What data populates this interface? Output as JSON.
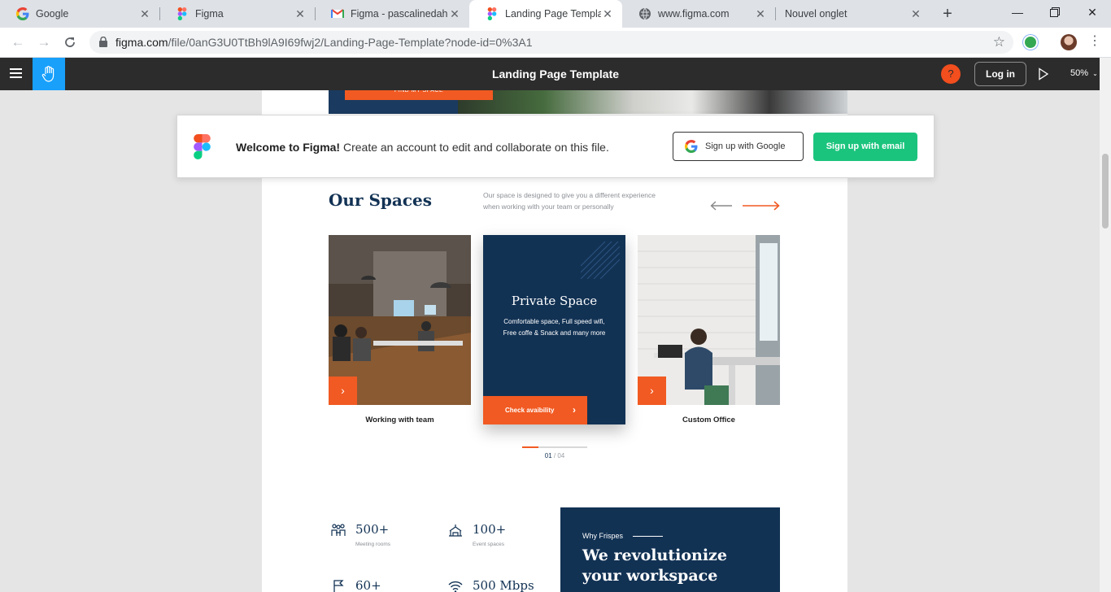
{
  "browser": {
    "tabs": [
      {
        "title": "Google",
        "icon": "google-icon"
      },
      {
        "title": "Figma",
        "icon": "figma-icon"
      },
      {
        "title": "Figma - pascalinedahzin",
        "icon": "gmail-icon"
      },
      {
        "title": "Landing Page Template",
        "icon": "figma-icon",
        "active": true
      },
      {
        "title": "www.figma.com",
        "icon": "globe-icon"
      },
      {
        "title": "Nouvel onglet",
        "icon": ""
      }
    ],
    "new_tab": "+",
    "url_host": "figma.com",
    "url_path": "/file/0anG3U0TtBh9lA9I69fwj2/Landing-Page-Template?node-id=0%3A1"
  },
  "figma": {
    "file_title": "Landing Page Template",
    "help": "?",
    "login": "Log in",
    "zoom": "50%"
  },
  "banner": {
    "welcome_bold": "Welcome to Figma!",
    "welcome_rest": " Create an account to edit and collaborate on this file.",
    "google_btn": "Sign up with Google",
    "email_btn": "Sign up with email"
  },
  "design": {
    "find_button": "FIND MY SPACE",
    "spaces_title": "Our Spaces",
    "spaces_desc": "Our space is designed to give you a different experience when working with your team or personally",
    "cards": [
      {
        "caption": "Working with team"
      },
      {
        "title": "Private Space",
        "desc": "Comfortable space, Full speed wifi, Free coffe & Snack and many more",
        "cta": "Check avaibility"
      },
      {
        "caption": "Custom Office"
      }
    ],
    "pager_current": "01",
    "pager_total": "/ 04",
    "progress_fraction": 0.25,
    "stats": [
      {
        "number": "500+",
        "label": "Meeting rooms",
        "icon": "people-icon"
      },
      {
        "number": "100+",
        "label": "Event spaces",
        "icon": "event-tent-icon"
      },
      {
        "number": "60+",
        "label": "",
        "icon": "flag-icon"
      },
      {
        "number": "500 Mbps",
        "label": "",
        "icon": "wifi-icon"
      }
    ],
    "why_kicker": "Why Frispes",
    "why_heading": "We revolutionize your workspace"
  },
  "colors": {
    "navy": "#123254",
    "orange": "#f15a22",
    "figma_green": "#1bc47d",
    "figma_blue": "#18a0fb"
  }
}
